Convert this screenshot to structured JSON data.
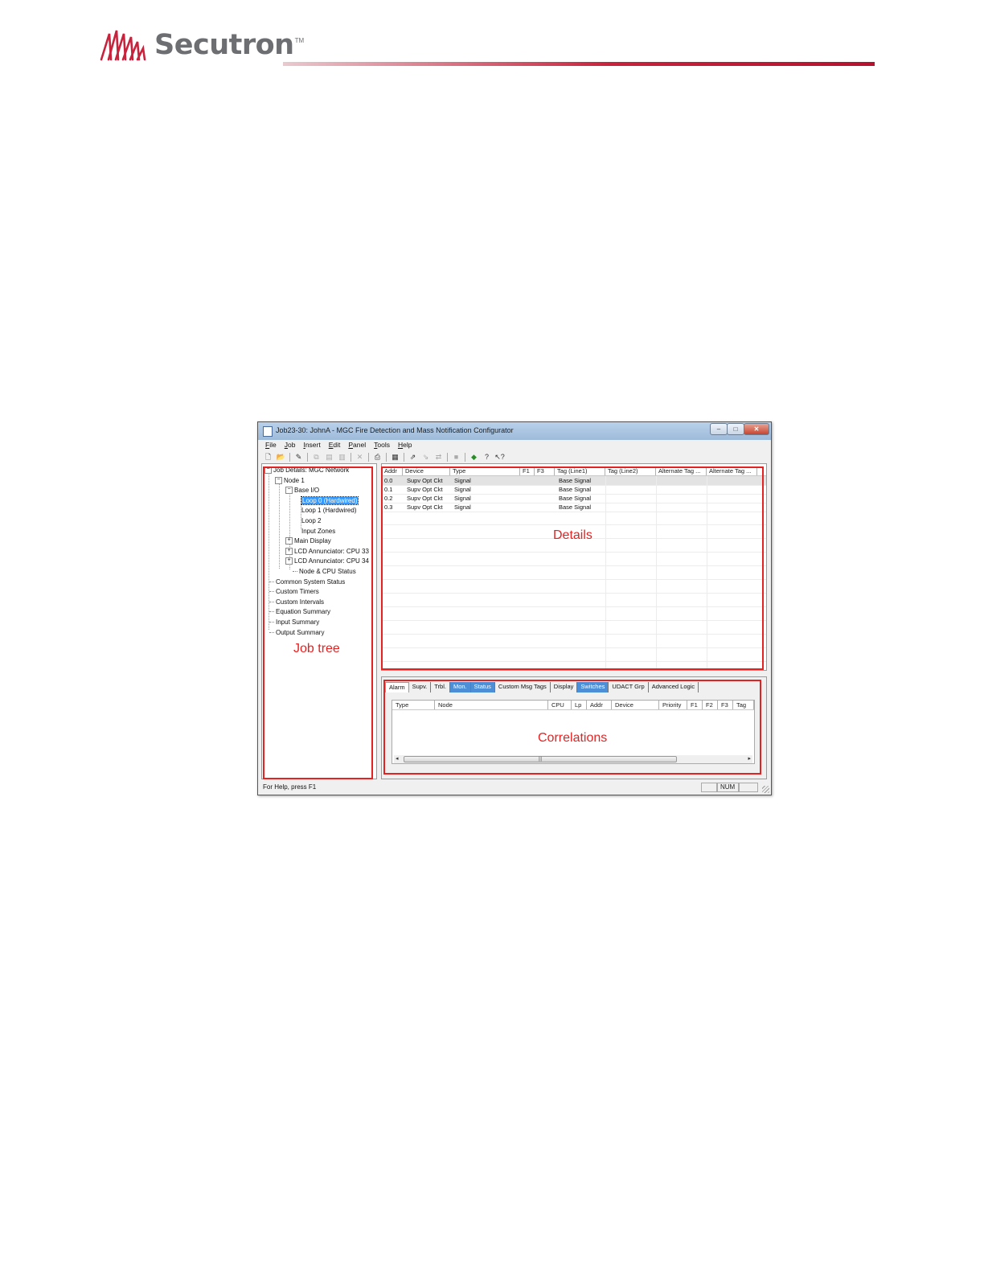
{
  "brand": {
    "name": "Secutron",
    "tm": "TM",
    "accent": "#c8233d",
    "text_color": "#6d6e71"
  },
  "window": {
    "title": "Job23-30: JohnA - MGC Fire Detection and Mass Notification Configurator",
    "controls": {
      "minimize": "–",
      "maximize": "□",
      "close": "✕"
    },
    "menu": [
      "File",
      "Job",
      "Insert",
      "Edit",
      "Panel",
      "Tools",
      "Help"
    ],
    "toolbar_icons": [
      "new-file-icon",
      "open-folder-icon",
      "edit-pencil-icon",
      "copy-icon",
      "paste-icon",
      "paste-special-icon",
      "delete-icon",
      "print-icon",
      "print-preview-icon",
      "upload-icon",
      "download-icon",
      "compare-icon",
      "stop-icon",
      "network-icon",
      "help-icon",
      "context-help-icon"
    ]
  },
  "tree": {
    "root": "Job Details: MGC Network",
    "node": "Node 1",
    "base_io": "Base I/O",
    "loop0": "Loop 0  (Hardwired)",
    "loop1": "Loop 1  (Hardwired)",
    "loop2": "Loop 2",
    "input_zones": "Input Zones",
    "main_display": "Main Display",
    "lcd1": "LCD Annunciator: CPU 33",
    "lcd2": "LCD Annunciator: CPU 34",
    "node_cpu_status": "Node & CPU Status",
    "common_status": "Common System Status",
    "custom_timers": "Custom Timers",
    "custom_intervals": "Custom Intervals",
    "equation_summary": "Equation Summary",
    "input_summary": "Input Summary",
    "output_summary": "Output Summary"
  },
  "details": {
    "columns": [
      "Addr",
      "Device",
      "Type",
      "F1",
      "F3",
      "Tag (Line1)",
      "Tag (Line2)",
      "Alternate Tag ...",
      "Alternate Tag ..."
    ],
    "rows": [
      {
        "addr": "0.0",
        "device": "Supv Opt Ckt",
        "type": "Signal",
        "tag1": "Base Signal"
      },
      {
        "addr": "0.1",
        "device": "Supv Opt Ckt",
        "type": "Signal",
        "tag1": "Base Signal"
      },
      {
        "addr": "0.2",
        "device": "Supv Opt Ckt",
        "type": "Signal",
        "tag1": "Base Signal"
      },
      {
        "addr": "0.3",
        "device": "Supv Opt Ckt",
        "type": "Signal",
        "tag1": "Base Signal"
      }
    ]
  },
  "correlations": {
    "tabs": [
      "Alarm",
      "Supv.",
      "Trbl.",
      "Mon.",
      "Status",
      "Custom Msg Tags",
      "Display",
      "Switches",
      "UDACT Grp",
      "Advanced Logic"
    ],
    "columns": [
      "Type",
      "Node",
      "CPU",
      "Lp",
      "Addr",
      "Device",
      "Priority",
      "F1",
      "F2",
      "F3",
      "Tag"
    ],
    "scroll_left": "◂",
    "scroll_right": "▸",
    "scroll_grip": "|||"
  },
  "statusbar": {
    "help_text": "For Help, press F1",
    "num": "NUM"
  },
  "annotations": {
    "job_tree": "Job tree",
    "details": "Details",
    "correlations": "Correlations",
    "color": "#e52222"
  }
}
